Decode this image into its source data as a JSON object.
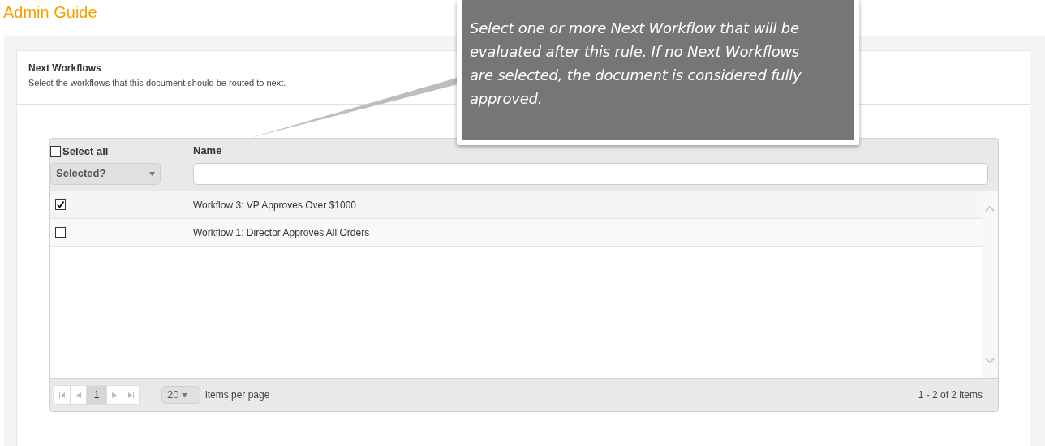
{
  "page_title": "Admin Guide",
  "section": {
    "title": "Next Workflows",
    "subtitle": "Select the workflows that this document should be routed to next."
  },
  "grid": {
    "select_all": {
      "label": "Select all",
      "checked": false
    },
    "selected_filter": "Selected?",
    "name_column": "Name",
    "rows": [
      {
        "checked": true,
        "name": "Workflow 3: VP Approves Over $1000"
      },
      {
        "checked": false,
        "name": "Workflow 1: Director Approves All Orders"
      }
    ],
    "pager": {
      "page": "1",
      "page_size": "20",
      "page_size_label": "items per page",
      "summary": "1 - 2 of 2 items"
    }
  },
  "callout": {
    "text": "Select one or more Next Workflow that will be evaluated after this rule. If no Next Workflows are selected, the document is considered fully approved."
  }
}
